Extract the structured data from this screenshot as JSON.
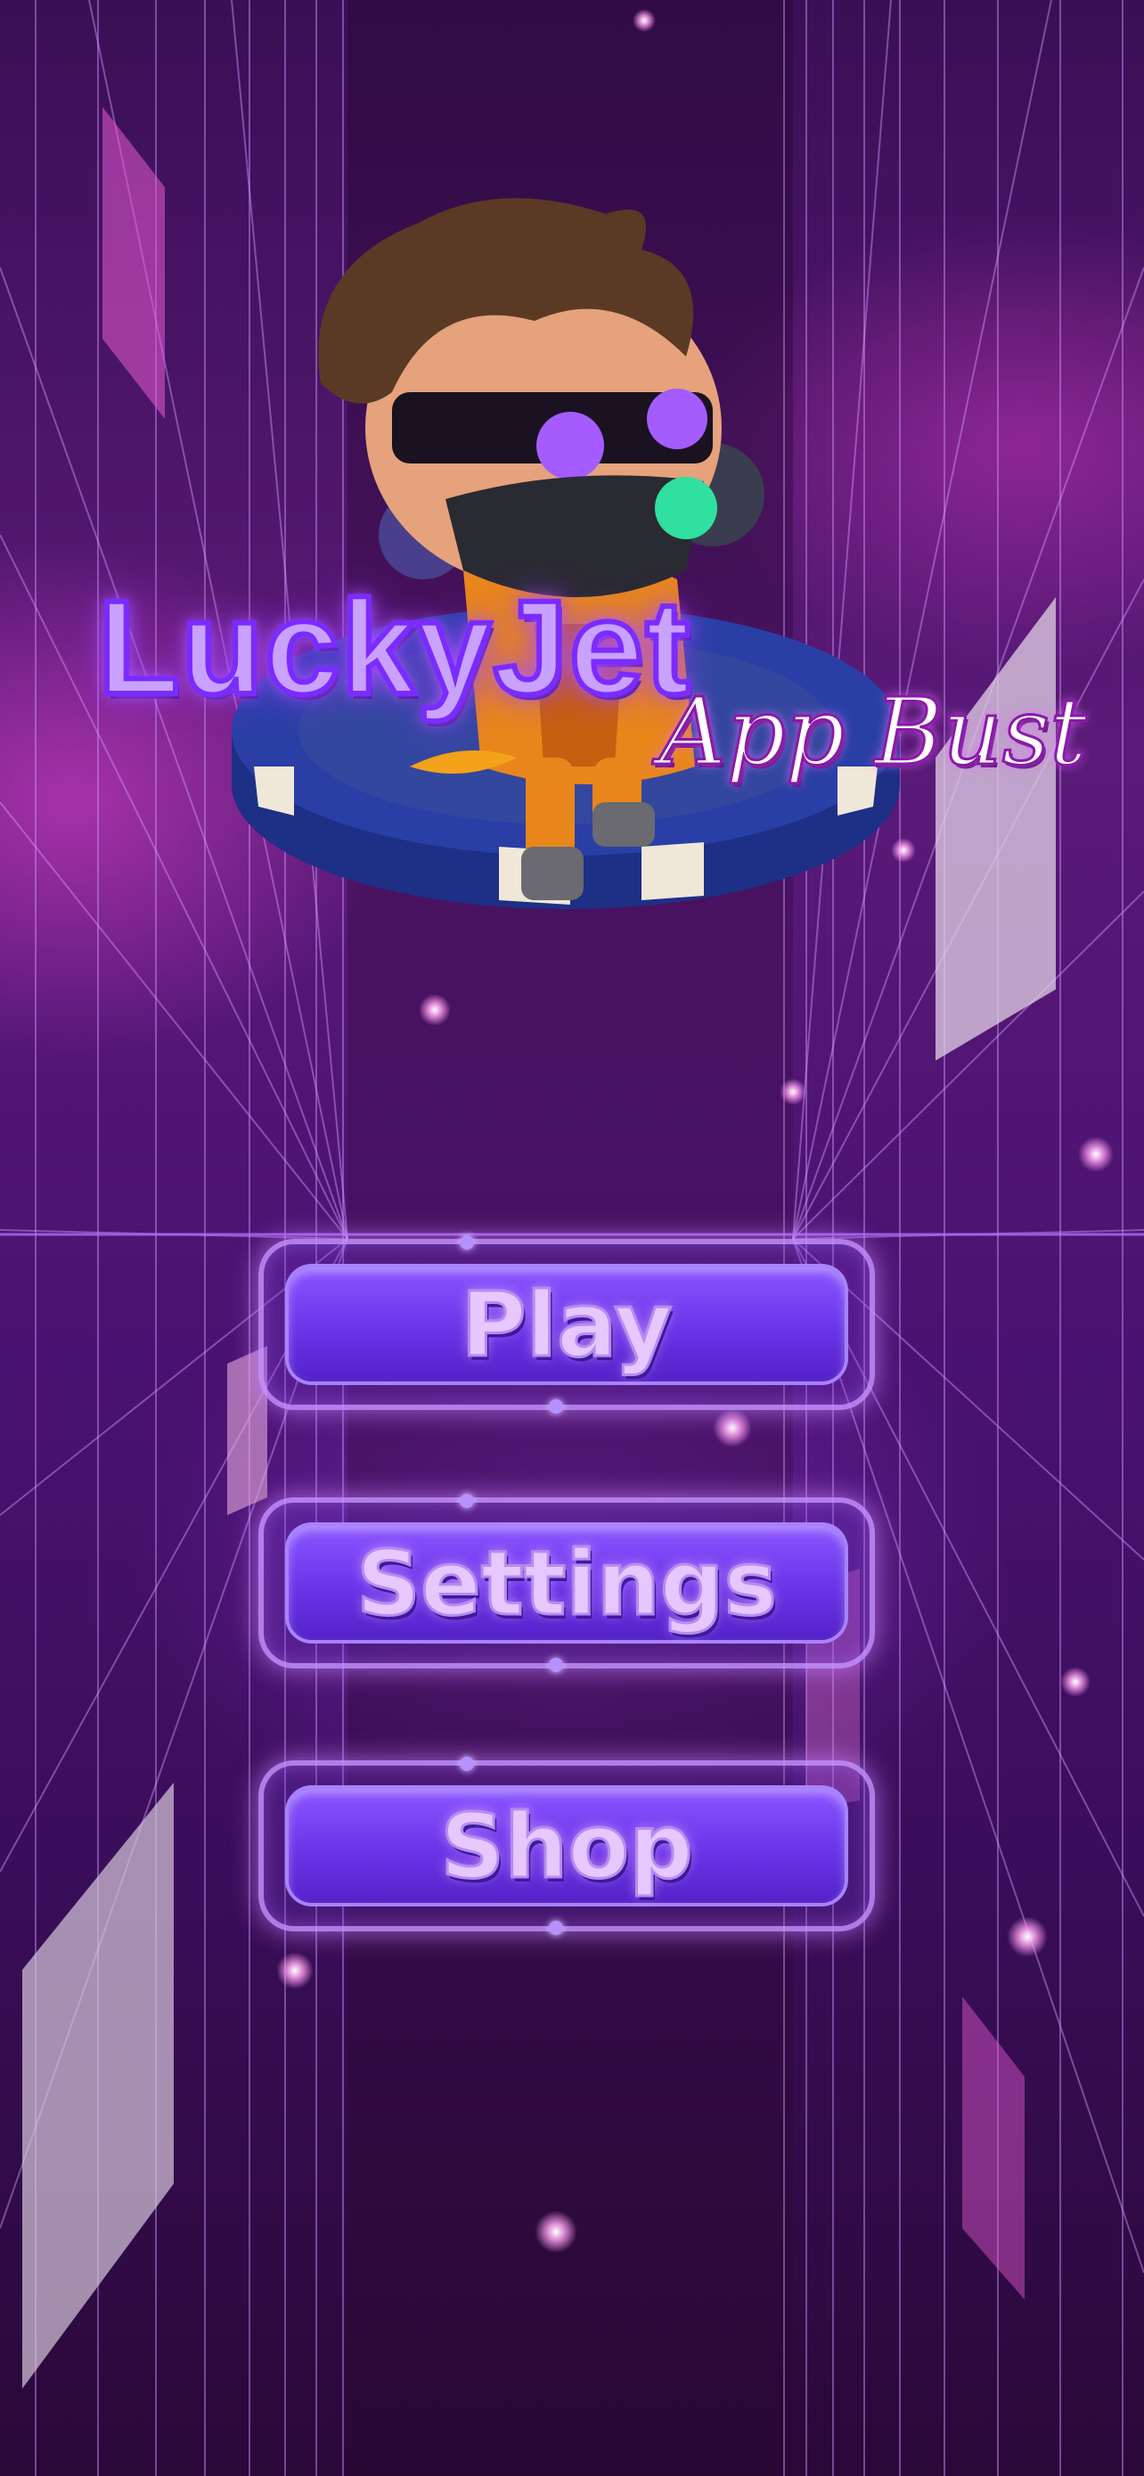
{
  "game": {
    "logo_main": "LuckyJet",
    "logo_sub": "App Bust"
  },
  "menu": {
    "play_label": "Play",
    "settings_label": "Settings",
    "shop_label": "Shop"
  },
  "colors": {
    "background": "#3a0f55",
    "accent": "#7a2cff",
    "button_face": "#6a34e8",
    "button_text": "#e6c8ff"
  },
  "icons": [
    "jetpack-character-icon",
    "poker-chip-icon"
  ]
}
